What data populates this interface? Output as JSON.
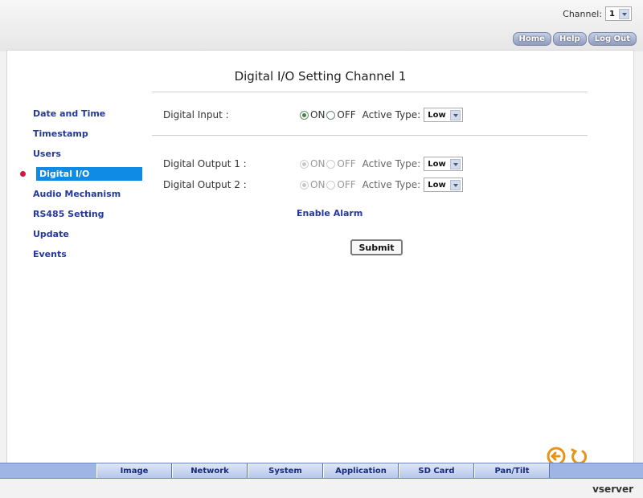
{
  "header": {
    "channel_label": "Channel:",
    "channel_value": "1",
    "nav": [
      "Home",
      "Help",
      "Log Out"
    ]
  },
  "page": {
    "title": "Digital I/O Setting Channel 1"
  },
  "sidebar": {
    "items": [
      {
        "label": "Date and Time"
      },
      {
        "label": "Timestamp"
      },
      {
        "label": "Users"
      },
      {
        "label": "Digital I/O"
      },
      {
        "label": "Audio Mechanism"
      },
      {
        "label": "RS485 Setting"
      },
      {
        "label": "Update"
      },
      {
        "label": "Events"
      }
    ]
  },
  "form": {
    "digital_input": {
      "label": "Digital Input :",
      "on": "ON",
      "off": "OFF",
      "active_type_label": "Active Type:",
      "active_type_value": "Low"
    },
    "digital_output_1": {
      "label": "Digital Output 1 :",
      "on": "ON",
      "off": "OFF",
      "active_type_label": "Active Type:",
      "active_type_value": "Low"
    },
    "digital_output_2": {
      "label": "Digital Output 2 :",
      "on": "ON",
      "off": "OFF",
      "active_type_label": "Active Type:",
      "active_type_value": "Low"
    },
    "enable_alarm": "Enable Alarm",
    "submit": "Submit"
  },
  "bottom_tabs": [
    "Image",
    "Network",
    "System",
    "Application",
    "SD Card",
    "Pan/Tilt"
  ],
  "footer": {
    "brand": "vserver"
  },
  "colors": {
    "accent": "#0f8be6",
    "link": "#26399a",
    "tabbar": "#9fb6e5"
  }
}
